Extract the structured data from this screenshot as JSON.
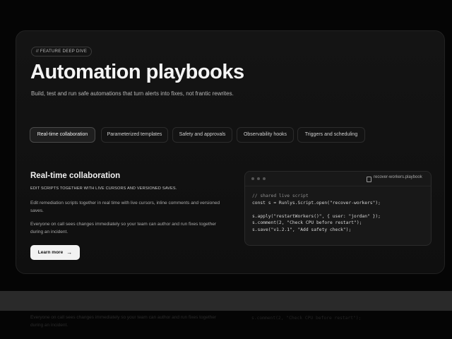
{
  "hero": {
    "eyebrow": "// FEATURE DEEP DIVE",
    "title": "Automation playbooks",
    "subtitle": "Build, test and run safe automations that turn alerts into fixes, not frantic rewrites."
  },
  "tabs": [
    {
      "label": "Real-time collaboration",
      "active": true
    },
    {
      "label": "Parameterized templates",
      "active": false
    },
    {
      "label": "Safety and approvals",
      "active": false
    },
    {
      "label": "Observability hooks",
      "active": false
    },
    {
      "label": "Triggers and scheduling",
      "active": false
    }
  ],
  "section": {
    "title": "Real-time collaboration",
    "eyebrow": "EDIT SCRIPTS TOGETHER WITH LIVE CURSORS AND VERSIONED SAVES.",
    "paragraph_1": "Edit remediation scripts together in real time with live cursors, inline comments and versioned saves.",
    "paragraph_2": "Everyone on call sees changes immediately so your team can author and run fixes together during an incident.",
    "button_label": "Learn more"
  },
  "code_window": {
    "file_name": "recover-workers.playbook",
    "lines": [
      "// shared live script",
      "const s = Runlys.Script.open(\"recover-workers\");",
      "",
      "s.apply(\"restartWorkers()\", { user: \"jordan\" });",
      "s.comment(2, \"Check CPU before restart\");",
      "s.save(\"v1.2.1\", \"Add safety check\");"
    ]
  },
  "colors": {
    "background": "#050505",
    "card": "#141414",
    "button": "#f2f2f2",
    "bottom_strip": "#2a2a2a"
  }
}
